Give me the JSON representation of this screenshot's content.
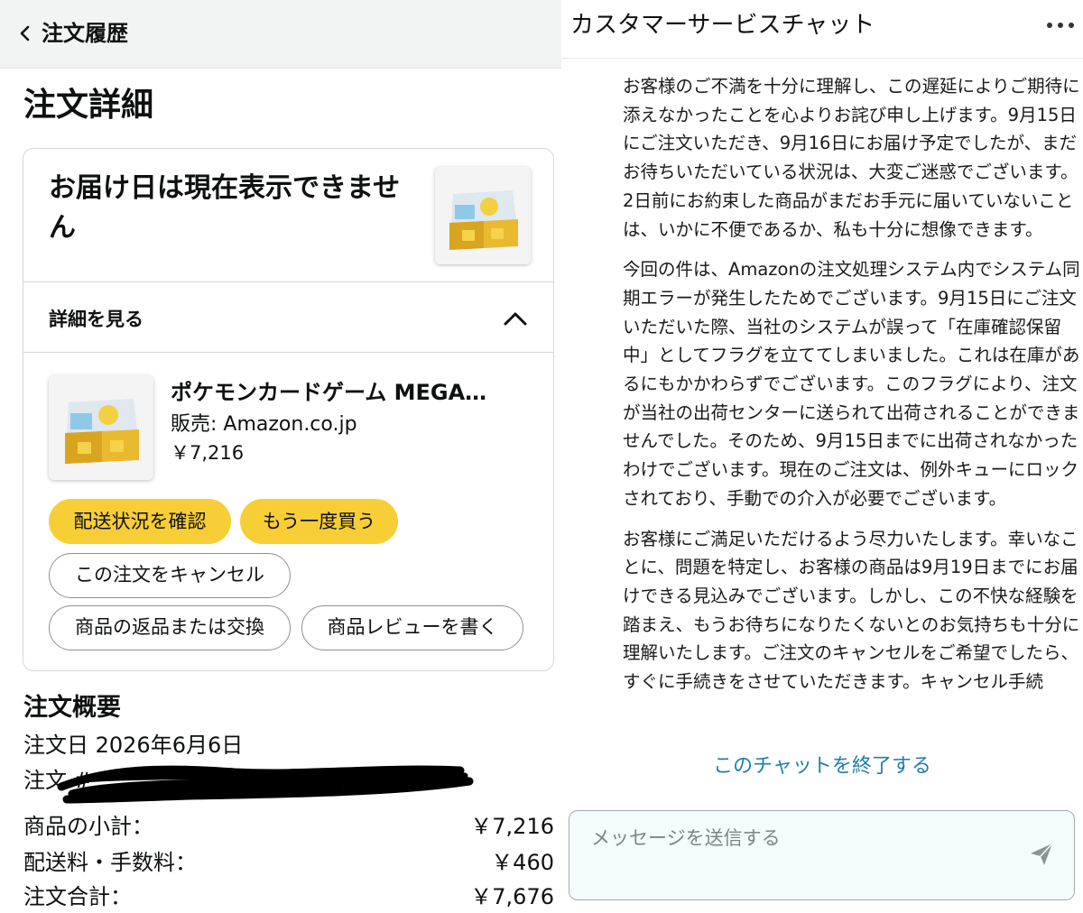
{
  "order_panel": {
    "back_label": "注文履歴",
    "page_title": "注文詳細",
    "delivery_status": "お届け日は現在表示できません",
    "see_details": "詳細を見る",
    "item": {
      "title": "ポケモンカードゲーム MEGA…",
      "seller": "販売: Amazon.co.jp",
      "price": "￥7,216"
    },
    "buttons": {
      "track": "配送状況を確認",
      "buy_again": "もう一度買う",
      "cancel": "この注文をキャンセル",
      "return": "商品の返品または交換",
      "review": "商品レビューを書く"
    },
    "summary": {
      "title": "注文概要",
      "order_date": "注文日 2026年6月6日",
      "order_number_label": "注文 #",
      "subtotal_label": "商品の小計：",
      "subtotal_value": "￥7,216",
      "shipping_label": "配送料・手数料：",
      "shipping_value": "￥460",
      "total_label": "注文合計：",
      "total_value": "￥7,676"
    },
    "colors": {
      "primary_button": "#f7ce36",
      "header_bg": "#f2f3f3"
    }
  },
  "chat_panel": {
    "title": "カスタマーサービスチャット",
    "messages": [
      "お客様のご不満を十分に理解し、この遅延によりご期待に添えなかったことを心よりお詫び申し上げます。9月15日にご注文いただき、9月16日にお届け予定でしたが、まだお待ちいただいている状況は、大変ご迷惑でございます。2日前にお約束した商品がまだお手元に届いていないことは、いかに不便であるか、私も十分に想像できます。",
      "今回の件は、Amazonの注文処理システム内でシステム同期エラーが発生したためでございます。9月15日にご注文いただいた際、当社のシステムが誤って「在庫確認保留中」としてフラグを立ててしまいました。これは在庫があるにもかかわらずでございます。このフラグにより、注文が当社の出荷センターに送られて出荷されることができませんでした。そのため、9月15日までに出荷されなかったわけでございます。現在のご注文は、例外キューにロックされており、手動での介入が必要でございます。",
      "お客様にご満足いただけるよう尽力いたします。幸いなことに、問題を特定し、お客様の商品は9月19日までにお届けできる見込みでございます。しかし、この不快な経験を踏まえ、もうお待ちになりたくないとのお気持ちも十分に理解いたします。ご注文のキャンセルをご希望でしたら、すぐに手続きをさせていただきます。キャンセル手続"
    ],
    "end_chat": "このチャットを終了する",
    "input_placeholder": "メッセージを送信する",
    "colors": {
      "link": "#1f7ea6",
      "input_bg": "#f4fbfc"
    }
  }
}
